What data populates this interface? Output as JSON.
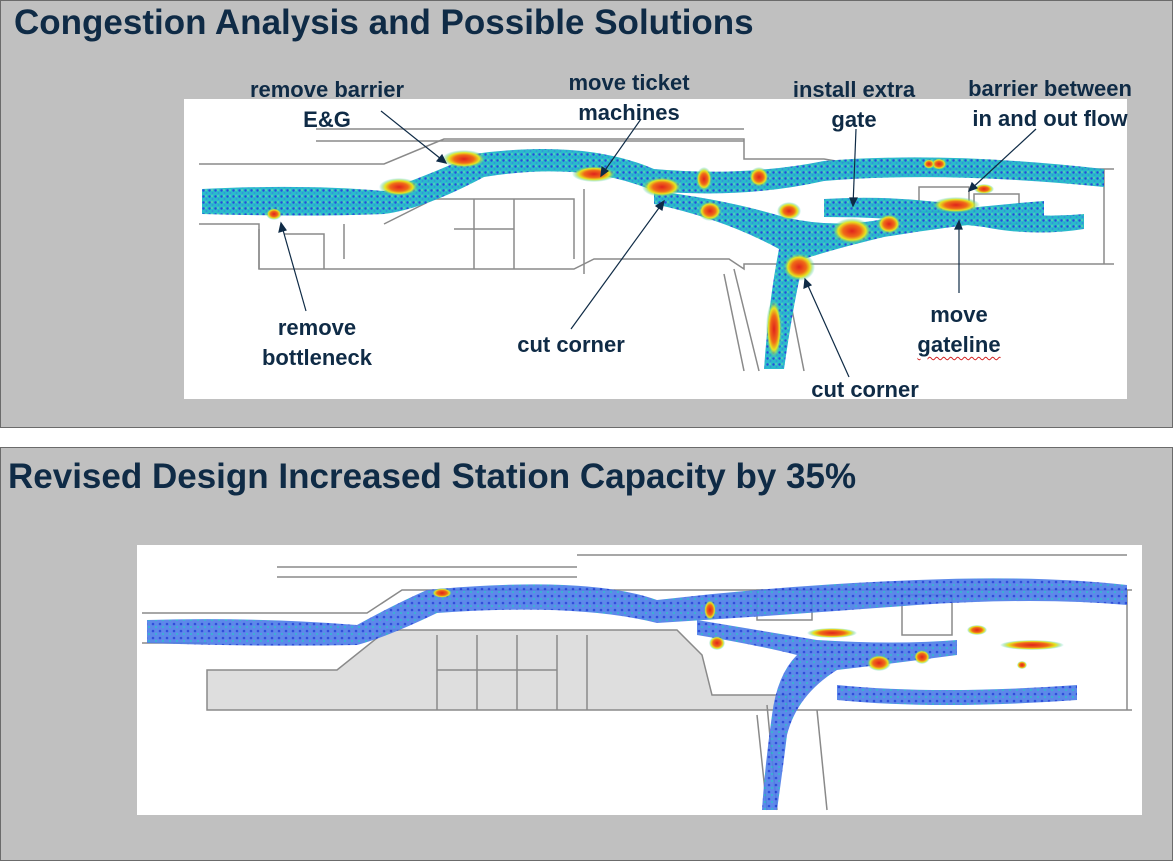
{
  "slides": {
    "top": {
      "title": "Congestion Analysis and Possible Solutions",
      "annotations": {
        "remove_barrier": "remove barrier\nE&G",
        "move_ticket": "move ticket\nmachines",
        "install_gate": "install extra\ngate",
        "barrier_flow": "barrier between\nin and out flow",
        "remove_bottleneck": "remove\nbottleneck",
        "cut_corner_1": "cut corner",
        "move_gateline_1": "move",
        "move_gateline_2": "gateline",
        "cut_corner_2": "cut corner"
      }
    },
    "bottom": {
      "title": "Revised Design Increased Station Capacity by 35%"
    }
  },
  "colors": {
    "panel": "#c0c0c0",
    "title": "#0f2b46",
    "density_low": "#1f3fd8",
    "density_mid": "#1fc7c7",
    "density_high": "#e6e620",
    "density_peak": "#e0231c",
    "wall": "#8a8a8a"
  }
}
